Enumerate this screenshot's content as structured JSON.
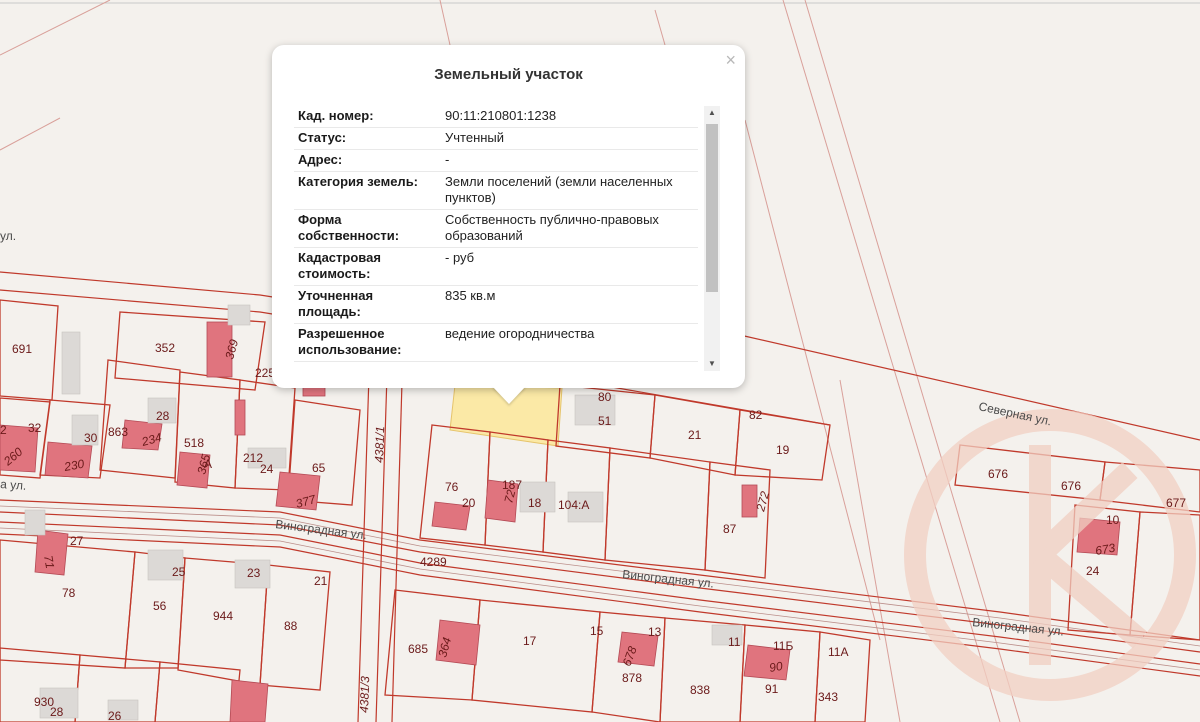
{
  "popup": {
    "title": "Земельный участок",
    "close_symbol": "×",
    "rows": [
      {
        "key": "Кад. номер:",
        "value": "90:11:210801:1238"
      },
      {
        "key": "Статус:",
        "value": "Учтенный"
      },
      {
        "key": "Адрес:",
        "value": "-"
      },
      {
        "key": "Категория земель:",
        "value": "Земли поселений (земли населенных пунктов)"
      },
      {
        "key": "Форма собственности:",
        "value": "Собственность публично-правовых образований"
      },
      {
        "key": "Кадастровая стоимость:",
        "value": "- руб"
      },
      {
        "key": "Уточненная площадь:",
        "value": "835 кв.м"
      },
      {
        "key": "Разрешенное использование:",
        "value": "ведение огородничества"
      }
    ]
  },
  "streets": {
    "vinogradnaya": "Виноградная ул.",
    "severnaya": "Северная ул.",
    "ul_fragment": "ул.",
    "ul_fragment_left": "а ул."
  },
  "lot_labels": [
    "691",
    "352",
    "369",
    "225",
    "32",
    "30",
    "863",
    "234",
    "28",
    "518",
    "365",
    "212",
    "24",
    "65",
    "377",
    "260",
    "230",
    "2",
    "80",
    "51",
    "21",
    "82",
    "19",
    "76",
    "20",
    "187",
    "72",
    "18",
    "104:А",
    "87",
    "272",
    "27",
    "71",
    "78",
    "25",
    "56",
    "23",
    "944",
    "21",
    "88",
    "4289",
    "4381/1",
    "4381/3",
    "685",
    "364",
    "17",
    "15",
    "13",
    "678",
    "878",
    "838",
    "11",
    "11Б",
    "11А",
    "90",
    "91",
    "343",
    "930",
    "28",
    "26",
    "676",
    "676",
    "677",
    "10",
    "673",
    "24",
    "А"
  ],
  "colors": {
    "boundary": "#c0392b",
    "building": "#e0747e",
    "selected_parcel": "#fbe9a6",
    "background": "#f4f1ed"
  }
}
